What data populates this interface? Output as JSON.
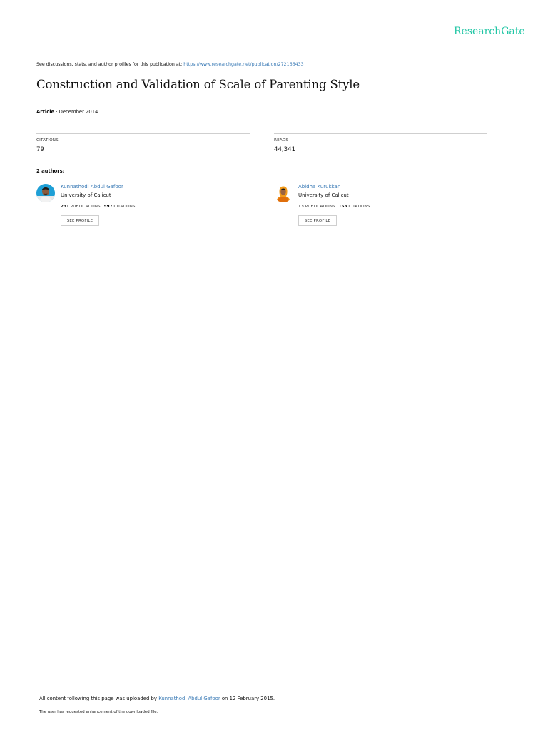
{
  "brand": {
    "name": "ResearchGate"
  },
  "discussion": {
    "prefix": "See discussions, stats, and author profiles for this publication at: ",
    "url": "https://www.researchgate.net/publication/272166433"
  },
  "publication": {
    "title": "Construction and Validation of Scale of Parenting Style",
    "type": "Article",
    "date": " · December 2014"
  },
  "stats": {
    "citations_label": "CITATIONS",
    "citations_value": "79",
    "reads_label": "READS",
    "reads_value": "44,341"
  },
  "authors_heading": "2 authors:",
  "authors": [
    {
      "name": "Kunnathodi Abdul Gafoor",
      "institution": "University of Calicut",
      "publications": "231",
      "publications_label": " PUBLICATIONS",
      "citations": "597",
      "citations_label": " CITATIONS",
      "button": "SEE PROFILE"
    },
    {
      "name": "Abidha Kurukkan",
      "institution": "University of Calicut",
      "publications": "13",
      "publications_label": " PUBLICATIONS",
      "citations": "153",
      "citations_label": " CITATIONS",
      "button": "SEE PROFILE"
    }
  ],
  "footer": {
    "uploaded_prefix": "All content following this page was uploaded by ",
    "uploader": "Kunnathodi Abdul Gafoor",
    "uploaded_suffix": " on 12 February 2015.",
    "enhancement_note": "The user has requested enhancement of the downloaded file."
  },
  "colors": {
    "brand": "#21c6a5",
    "link": "#3b7bb6"
  },
  "icons": {
    "author_1_avatar": "author-photo",
    "author_2_avatar": "author-photo"
  }
}
